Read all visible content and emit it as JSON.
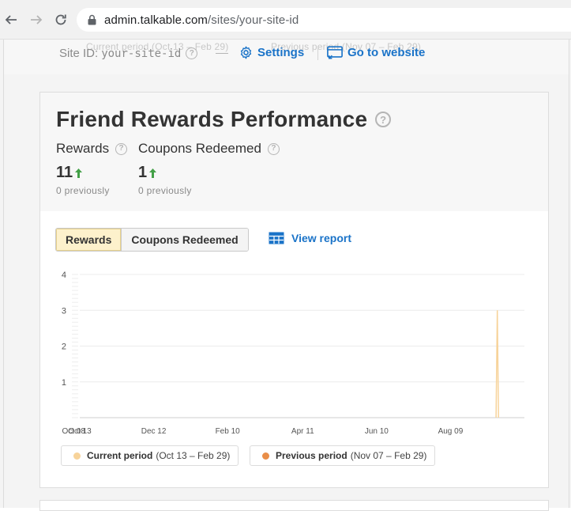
{
  "browser": {
    "url_host": "admin.talkable.com",
    "url_path": "/sites/your-site-id"
  },
  "header": {
    "ghost_left": "Current period (Oct 13 – Feb 29)",
    "ghost_right": "Previous period (Nov 07 – Feb 29)",
    "site_id_label": "Site ID:",
    "site_id_value": "your-site-id",
    "help": "?",
    "settings_label": "Settings",
    "website_label": "Go to website"
  },
  "card": {
    "title": "Friend Rewards Performance",
    "help": "?",
    "stats": [
      {
        "label": "Rewards",
        "value": "11",
        "previous": "0 previously"
      },
      {
        "label": "Coupons Redeemed",
        "value": "1",
        "previous": "0 previously"
      }
    ],
    "toggle": [
      "Rewards",
      "Coupons Redeemed"
    ],
    "view_report": "View report"
  },
  "legend": {
    "current_label": "Current period",
    "current_range": "(Oct 13 – Feb 29)",
    "previous_label": "Previous period",
    "previous_range": "(Nov 07 – Feb 29)"
  },
  "colors": {
    "current": "#f7d39a",
    "previous": "#e98e48",
    "link": "#1a73c8",
    "up_arrow": "#43a047"
  },
  "chart_data": {
    "type": "line",
    "x_ticks": [
      "Oct 13",
      "Dec 12",
      "Feb 10",
      "Apr 11",
      "Jun 10",
      "Aug 09",
      "Oct 08"
    ],
    "y_ticks": [
      1,
      2,
      3,
      4
    ],
    "ylim": [
      0,
      4
    ],
    "grid": true,
    "series": [
      {
        "name": "Current period",
        "color": "#f7d39a",
        "points": [
          [
            "Sep 15",
            0
          ],
          [
            "Sep 16",
            3
          ],
          [
            "Sep 17",
            0
          ]
        ]
      },
      {
        "name": "Previous period",
        "color": "#e98e48",
        "points": []
      }
    ],
    "legend": "bottom"
  }
}
